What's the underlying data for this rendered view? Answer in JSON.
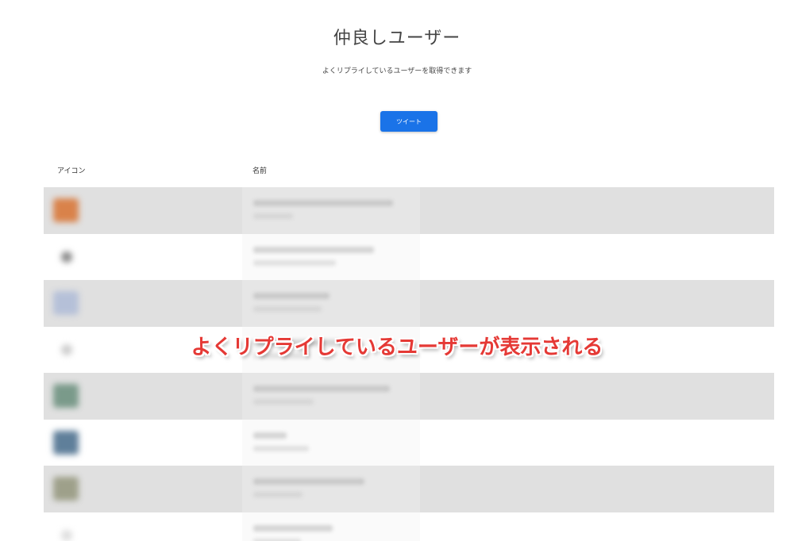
{
  "header": {
    "title": "仲良しユーザー",
    "subtitle": "よくリプライしているユーザーを取得できます",
    "tweet_button_label": "ツイート"
  },
  "table": {
    "columns": [
      "アイコン",
      "名前"
    ],
    "rows": [
      {
        "avatar_color": "#d9824a",
        "avatar_style": "square",
        "name_width": 176,
        "handle_width": 50
      },
      {
        "avatar_color": "#888888",
        "avatar_style": "small",
        "name_width": 152,
        "handle_width": 104
      },
      {
        "avatar_color": "#b5c0d8",
        "avatar_style": "square",
        "name_width": 96,
        "handle_width": 86
      },
      {
        "avatar_color": "#cccccc",
        "avatar_style": "small",
        "name_width": 120,
        "handle_width": 70
      },
      {
        "avatar_color": "#7a9a8a",
        "avatar_style": "square",
        "name_width": 172,
        "handle_width": 76
      },
      {
        "avatar_color": "#5f7f9a",
        "avatar_style": "square",
        "name_width": 42,
        "handle_width": 70
      },
      {
        "avatar_color": "#9ea08a",
        "avatar_style": "square",
        "name_width": 140,
        "handle_width": 62
      },
      {
        "avatar_color": "#dddddd",
        "avatar_style": "small",
        "name_width": 100,
        "handle_width": 60
      }
    ]
  },
  "annotation": {
    "caption": "よくリプライしているユーザーが表示される",
    "color": "#e53935"
  },
  "colors": {
    "accent": "#1a73e8",
    "row_stripe": "#e0e0e0"
  }
}
